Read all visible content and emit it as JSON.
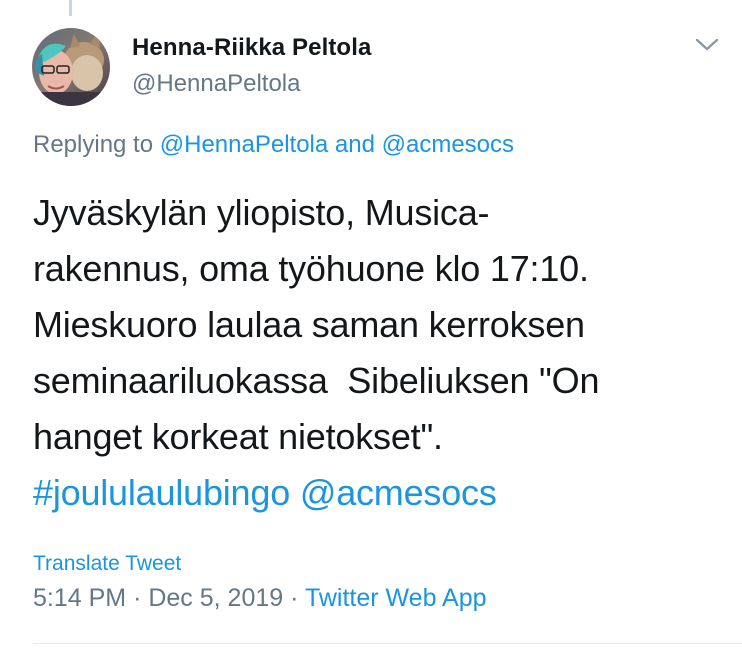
{
  "tweet": {
    "author": {
      "display_name": "Henna-Riikka Peltola",
      "handle": "@HennaPeltola"
    },
    "replying_to": {
      "prefix": "Replying to",
      "mention_1": "@HennaPeltola",
      "conjunction": "and",
      "mention_2": "@acmesocs"
    },
    "text_lines": [
      "Jyväskylän yliopisto, Musica-",
      "rakennus, oma työhuone klo 17:10.",
      "Mieskuoro laulaa saman kerroksen",
      "seminaariluokassa  Sibeliuksen \"On",
      "hanget korkeat nietokset\"."
    ],
    "hashtag": "#joululaulubingo",
    "mention": "@acmesocs",
    "translate_label": "Translate Tweet",
    "time": "5:14 PM",
    "separator": "·",
    "date": "Dec 5, 2019",
    "source": "Twitter Web App"
  },
  "icons": {
    "menu": "chevron-down-icon"
  },
  "colors": {
    "text": "#14171a",
    "secondary": "#657786",
    "link": "#1b95e0",
    "divider": "#e6ecf0"
  }
}
